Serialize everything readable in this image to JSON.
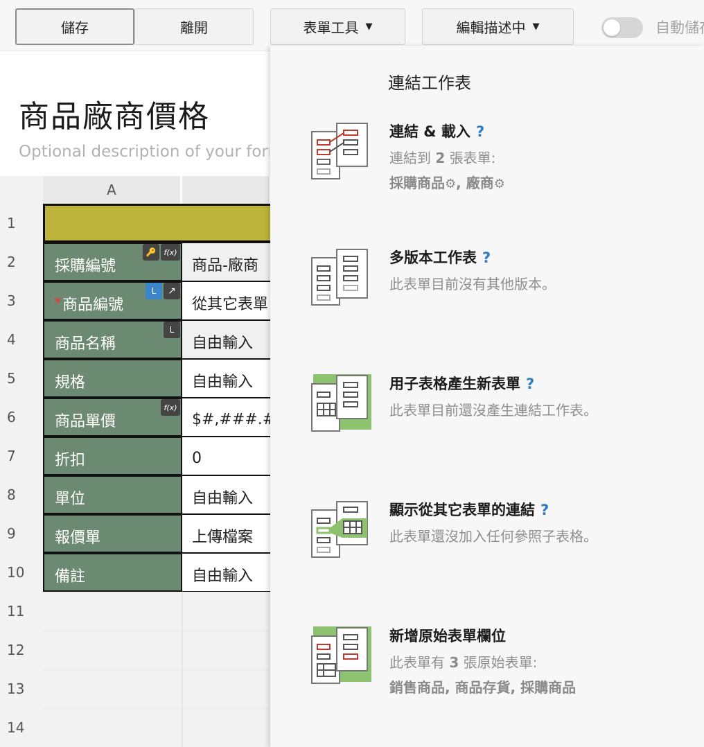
{
  "toolbar": {
    "save_label": "儲存",
    "leave_label": "離開",
    "form_tools_label": "表單工具",
    "edit_mode_label": "編輯描述中",
    "autosave_label": "自動儲存",
    "autosave_on": false
  },
  "form": {
    "title": "商品廠商價格",
    "description_placeholder": "Optional description of your form"
  },
  "sheet": {
    "column_headers": [
      "A",
      ""
    ],
    "row_numbers": [
      "1",
      "2",
      "3",
      "4",
      "5",
      "6",
      "7",
      "8",
      "9",
      "10",
      "11",
      "12",
      "13",
      "14"
    ],
    "rows": [
      {
        "label": "採購編號",
        "value": "商品-廠商",
        "required": "",
        "value_grey": true,
        "badges": [
          "key",
          "fx"
        ]
      },
      {
        "label": "商品編號",
        "value": "從其它表單",
        "required": "*",
        "value_grey": false,
        "badges": [
          "L",
          "link"
        ]
      },
      {
        "label": "商品名稱",
        "value": "自由輸入",
        "required": "",
        "value_grey": true,
        "badges": [
          "L"
        ]
      },
      {
        "label": "規格",
        "value": "自由輸入",
        "required": "",
        "value_grey": false,
        "badges": []
      },
      {
        "label": "商品單價",
        "value": "$#,###.##",
        "required": "",
        "value_grey": false,
        "badges": [
          "fx"
        ]
      },
      {
        "label": "折扣",
        "value": "0",
        "required": "",
        "value_grey": false,
        "badges": []
      },
      {
        "label": "單位",
        "value": "自由輸入",
        "required": "",
        "value_grey": false,
        "badges": []
      },
      {
        "label": "報價單",
        "value": "上傳檔案",
        "required": "",
        "value_grey": false,
        "badges": []
      },
      {
        "label": "備註",
        "value": "自由輸入",
        "required": "",
        "value_grey": false,
        "badges": []
      }
    ],
    "badge_text": {
      "L": "L",
      "fx": "f(x)"
    }
  },
  "panel": {
    "title": "連結工作表",
    "help_mark": "?",
    "items": [
      {
        "icon": "link-load-icon",
        "title": "連結 & 載入",
        "lines": [
          "連結到 2 張表單:",
          "採購商品, 廠商"
        ]
      },
      {
        "icon": "multi-version-icon",
        "title": "多版本工作表",
        "lines": [
          "此表單目前沒有其他版本。"
        ]
      },
      {
        "icon": "subtable-new-form-icon",
        "title": "用子表格產生新表單",
        "lines": [
          "此表單目前還沒產生連結工作表。"
        ]
      },
      {
        "icon": "show-links-icon",
        "title": "顯示從其它表單的連結",
        "lines": [
          "此表單還沒加入任何參照子表格。"
        ]
      },
      {
        "icon": "add-source-field-icon",
        "title": "新增原始表單欄位",
        "lines": [
          "此表單有 3 張原始表單:",
          "銷售商品, 商品存貨, 採購商品"
        ]
      }
    ],
    "link_prefix": "連結到",
    "link_count": "2",
    "link_suffix": "張表單:",
    "link_forms": [
      "採購商品",
      "廠商"
    ],
    "source_prefix": "此表單有",
    "source_count": "3",
    "source_suffix": "張原始表單:",
    "source_forms": "銷售商品, 商品存貨, 採購商品"
  },
  "colors": {
    "label_fill": "#6c8a71",
    "header_row_fill": "#bdb53b",
    "help_blue": "#2f7dc0",
    "icon_red": "#c0392b",
    "icon_green": "#8dc26f"
  }
}
